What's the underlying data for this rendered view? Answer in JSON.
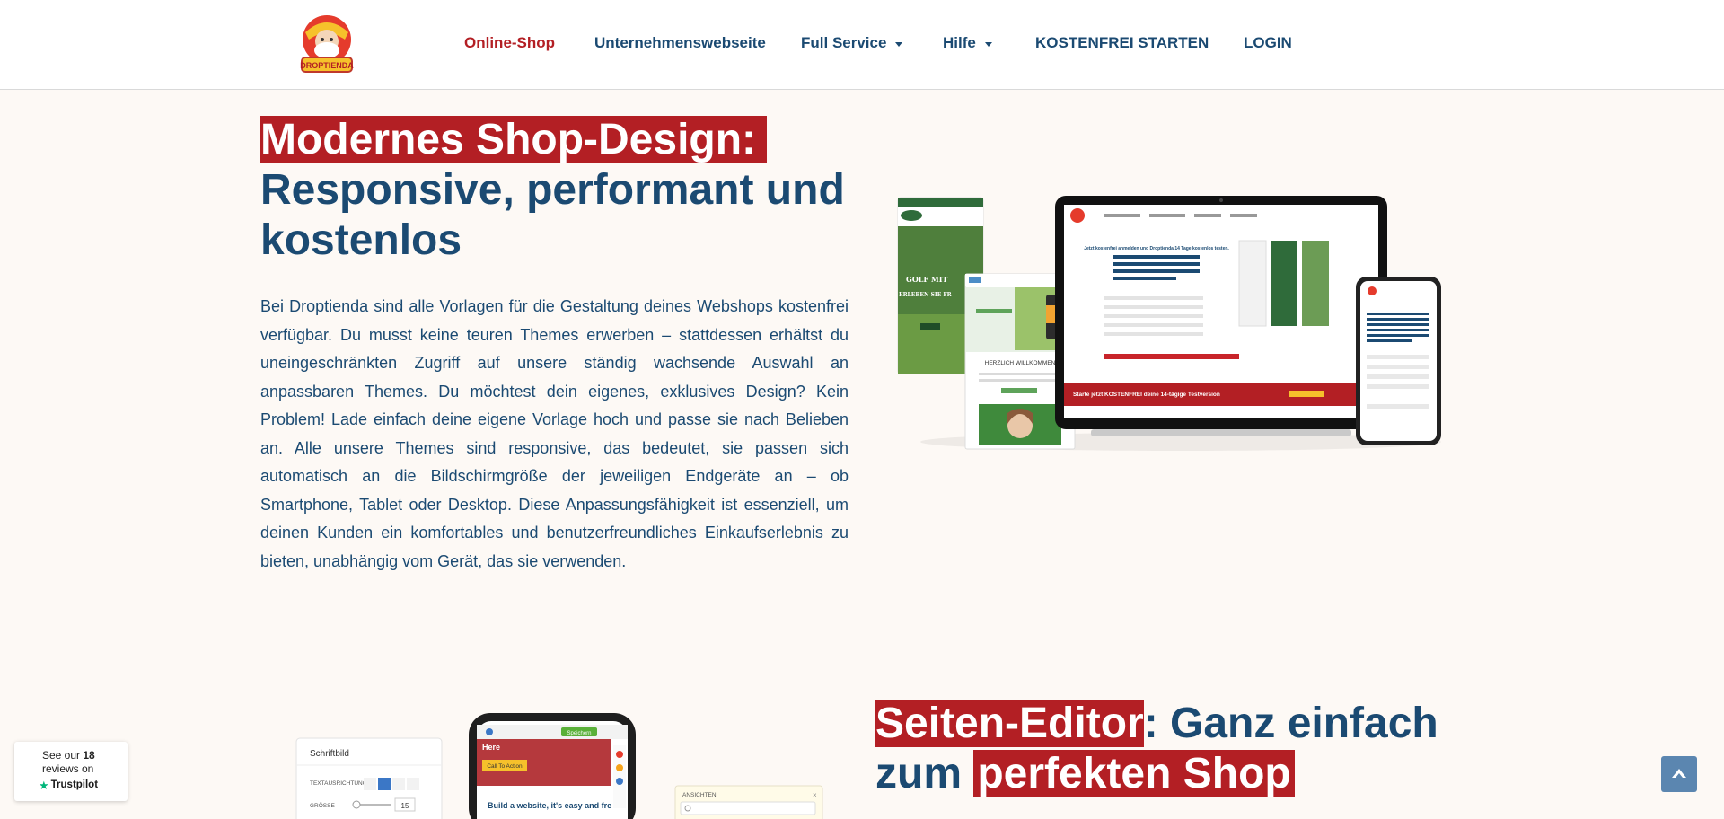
{
  "header": {
    "logo_text": "DROPTIENDA",
    "nav": [
      {
        "label": "Online-Shop"
      },
      {
        "label": "Unternehmenswebseite"
      },
      {
        "label": "Full Service"
      },
      {
        "label": "Hilfe"
      },
      {
        "label": "KOSTENFREI STARTEN"
      },
      {
        "label": "LOGIN"
      }
    ]
  },
  "section1": {
    "title_highlight": "Modernes Shop-Design:",
    "title_rest": "Responsive, performant und kostenlos",
    "paragraph": "Bei Droptienda sind alle Vorlagen für die Gestaltung deines Webshops kostenfrei verfügbar. Du musst keine teuren Themes erwerben – stattdessen erhältst du uneingeschränkten Zugriff auf unsere ständig wachsende Auswahl an anpassbaren Themes. Du möchtest dein eigenes, exklusives Design? Kein Problem! Lade einfach deine eigene Vorlage hoch und passe sie nach Belieben an. Alle unsere Themes sind responsive, das bedeutet, sie passen sich automatisch an die Bildschirmgröße der jeweiligen Endgeräte an – ob Smartphone, Tablet oder Desktop. Diese Anpassungsfähigkeit ist essenziell, um deinen Kunden ein komfortables und benutzerfreundliches Einkaufserlebnis zu bieten, unabhängig vom Gerät, das sie verwenden.",
    "mockup": {
      "laptop_banner": "Starte jetzt KOSTENFREI deine 14-tägige Testversion",
      "laptop_heading": "Jetzt kostenfrei anmelden und Droptienda 14 Tage kostenlos testen.",
      "tablet_title": "GOLF MIT",
      "tablet_sub": "ERLEBEN SIE FR",
      "phone_welcome": "HERZLICH WILLKOMMEN"
    }
  },
  "section2": {
    "title_part1_highlight": "Seiten-Editor",
    "title_part2": ": Ganz einfach zum ",
    "title_part3_highlight": "perfekten Shop",
    "editor": {
      "panel_title": "Schriftbild",
      "row1_label": "TEXTAUSRICHTUNG",
      "row2_label": "GRÖSSE",
      "size_value": "15",
      "phone_hero": "Here",
      "phone_cta": "Call To Action",
      "phone_text": "Build a website, it's easy and fre",
      "phone_btn": "Speichern",
      "side_panel_title": "ANSICHTEN"
    }
  },
  "trustpilot": {
    "line1_prefix": "See our ",
    "count": "18",
    "line2": "reviews on",
    "brand": "Trustpilot"
  },
  "colors": {
    "primary": "#1b4a72",
    "accent": "#b31f24",
    "background": "#fdf9f5"
  }
}
